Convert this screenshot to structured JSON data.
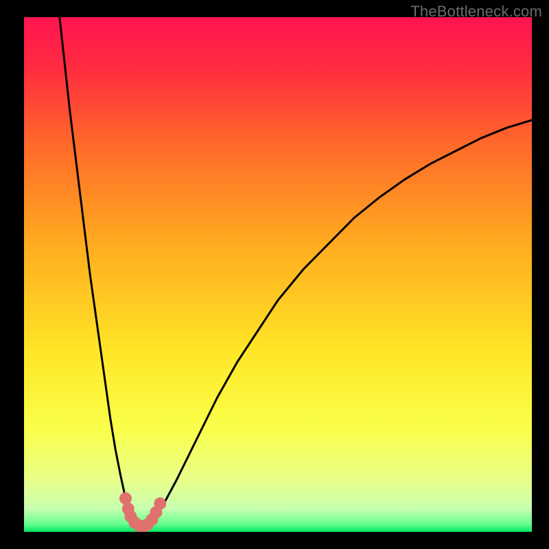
{
  "watermark": "TheBottleneck.com",
  "chart_data": {
    "type": "line",
    "title": "",
    "xlabel": "",
    "ylabel": "",
    "xlim": [
      0,
      100
    ],
    "ylim": [
      0,
      100
    ],
    "grid": false,
    "comment": "Axes are unlabeled; values below are estimated from the plotted curve shape. y=0 is the green band at the bottom, y=100 is the top. x is horizontal position left-to-right.",
    "series": [
      {
        "name": "bottleneck-curve",
        "x": [
          7,
          8,
          9,
          10,
          11,
          12,
          13,
          14,
          15,
          16,
          17,
          18,
          19,
          20,
          21,
          22,
          23.5,
          25,
          27,
          30,
          34,
          38,
          42,
          46,
          50,
          55,
          60,
          65,
          70,
          75,
          80,
          85,
          90,
          95,
          100
        ],
        "y": [
          100,
          91,
          82,
          74,
          66,
          58,
          50,
          43,
          36,
          29,
          22,
          16,
          11,
          6.5,
          3.5,
          1.8,
          1.0,
          1.8,
          4.5,
          10,
          18,
          26,
          33,
          39,
          45,
          51,
          56,
          61,
          65,
          68.5,
          71.5,
          74,
          76.5,
          78.5,
          80
        ]
      }
    ],
    "marker_cluster": {
      "name": "bottom-markers",
      "comment": "Salmon-colored dot cluster near curve minimum, roughly x in [20,27], y slightly above the bottom band.",
      "color": "#e0726d",
      "points": [
        {
          "x": 20.0,
          "y": 6.5
        },
        {
          "x": 20.5,
          "y": 4.5
        },
        {
          "x": 21.0,
          "y": 3.0
        },
        {
          "x": 21.8,
          "y": 1.8
        },
        {
          "x": 22.7,
          "y": 1.2
        },
        {
          "x": 23.5,
          "y": 1.0
        },
        {
          "x": 24.3,
          "y": 1.4
        },
        {
          "x": 25.2,
          "y": 2.4
        },
        {
          "x": 26.0,
          "y": 3.8
        },
        {
          "x": 26.8,
          "y": 5.5
        }
      ]
    },
    "background_gradient": {
      "type": "vertical",
      "stops": [
        {
          "pos": 0.0,
          "color": "#ff1450"
        },
        {
          "pos": 0.1,
          "color": "#ff2c3f"
        },
        {
          "pos": 0.25,
          "color": "#ff6a29"
        },
        {
          "pos": 0.45,
          "color": "#ffae1f"
        },
        {
          "pos": 0.65,
          "color": "#ffe627"
        },
        {
          "pos": 0.8,
          "color": "#faff4a"
        },
        {
          "pos": 0.9,
          "color": "#e8ff8a"
        },
        {
          "pos": 0.955,
          "color": "#c8ffb0"
        },
        {
          "pos": 0.985,
          "color": "#66ff90"
        },
        {
          "pos": 1.0,
          "color": "#00e763"
        }
      ]
    }
  }
}
